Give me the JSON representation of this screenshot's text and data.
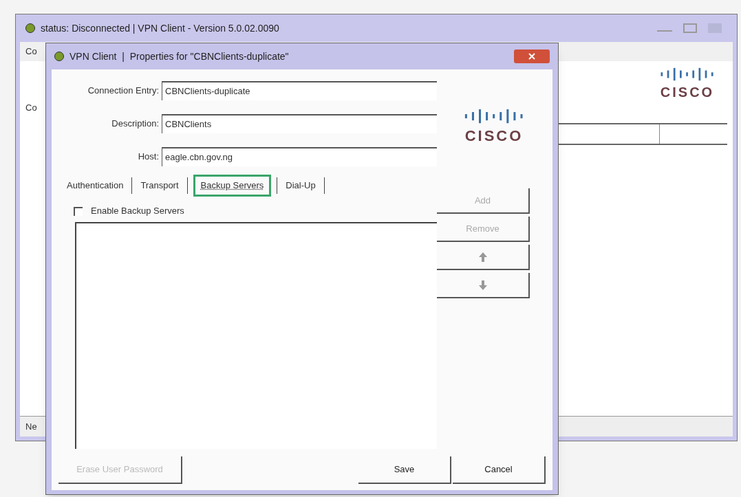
{
  "main_window": {
    "title": "status: Disconnected | VPN Client - Version 5.0.02.0090",
    "menu_fragment": "Co",
    "tab_fragment": "Co",
    "status_fragment": "Ne",
    "logo_text": "CISCO"
  },
  "dialog": {
    "title": "VPN Client  |  Properties for \"CBNClients-duplicate\"",
    "fields": [
      {
        "label": "Connection Entry:",
        "value": "CBNClients-duplicate"
      },
      {
        "label": "Description:",
        "value": "CBNClients"
      },
      {
        "label": "Host:",
        "value": "eagle.cbn.gov.ng"
      }
    ],
    "logo_text": "CISCO",
    "tabs": [
      {
        "label": "Authentication",
        "selected": false
      },
      {
        "label": "Transport",
        "selected": false
      },
      {
        "label": "Backup Servers",
        "selected": true
      },
      {
        "label": "Dial-Up",
        "selected": false
      }
    ],
    "enable_backup": {
      "label": "Enable Backup Servers",
      "checked": false
    },
    "side_buttons": [
      {
        "kind": "text",
        "label": "Add",
        "disabled": true
      },
      {
        "kind": "text",
        "label": "Remove",
        "disabled": true
      },
      {
        "kind": "up",
        "disabled": true
      },
      {
        "kind": "down",
        "disabled": true
      }
    ],
    "footer_buttons": [
      {
        "label": "Erase User Password",
        "disabled": true
      },
      {
        "label": "Save",
        "disabled": false
      },
      {
        "label": "Cancel",
        "disabled": false
      }
    ]
  }
}
